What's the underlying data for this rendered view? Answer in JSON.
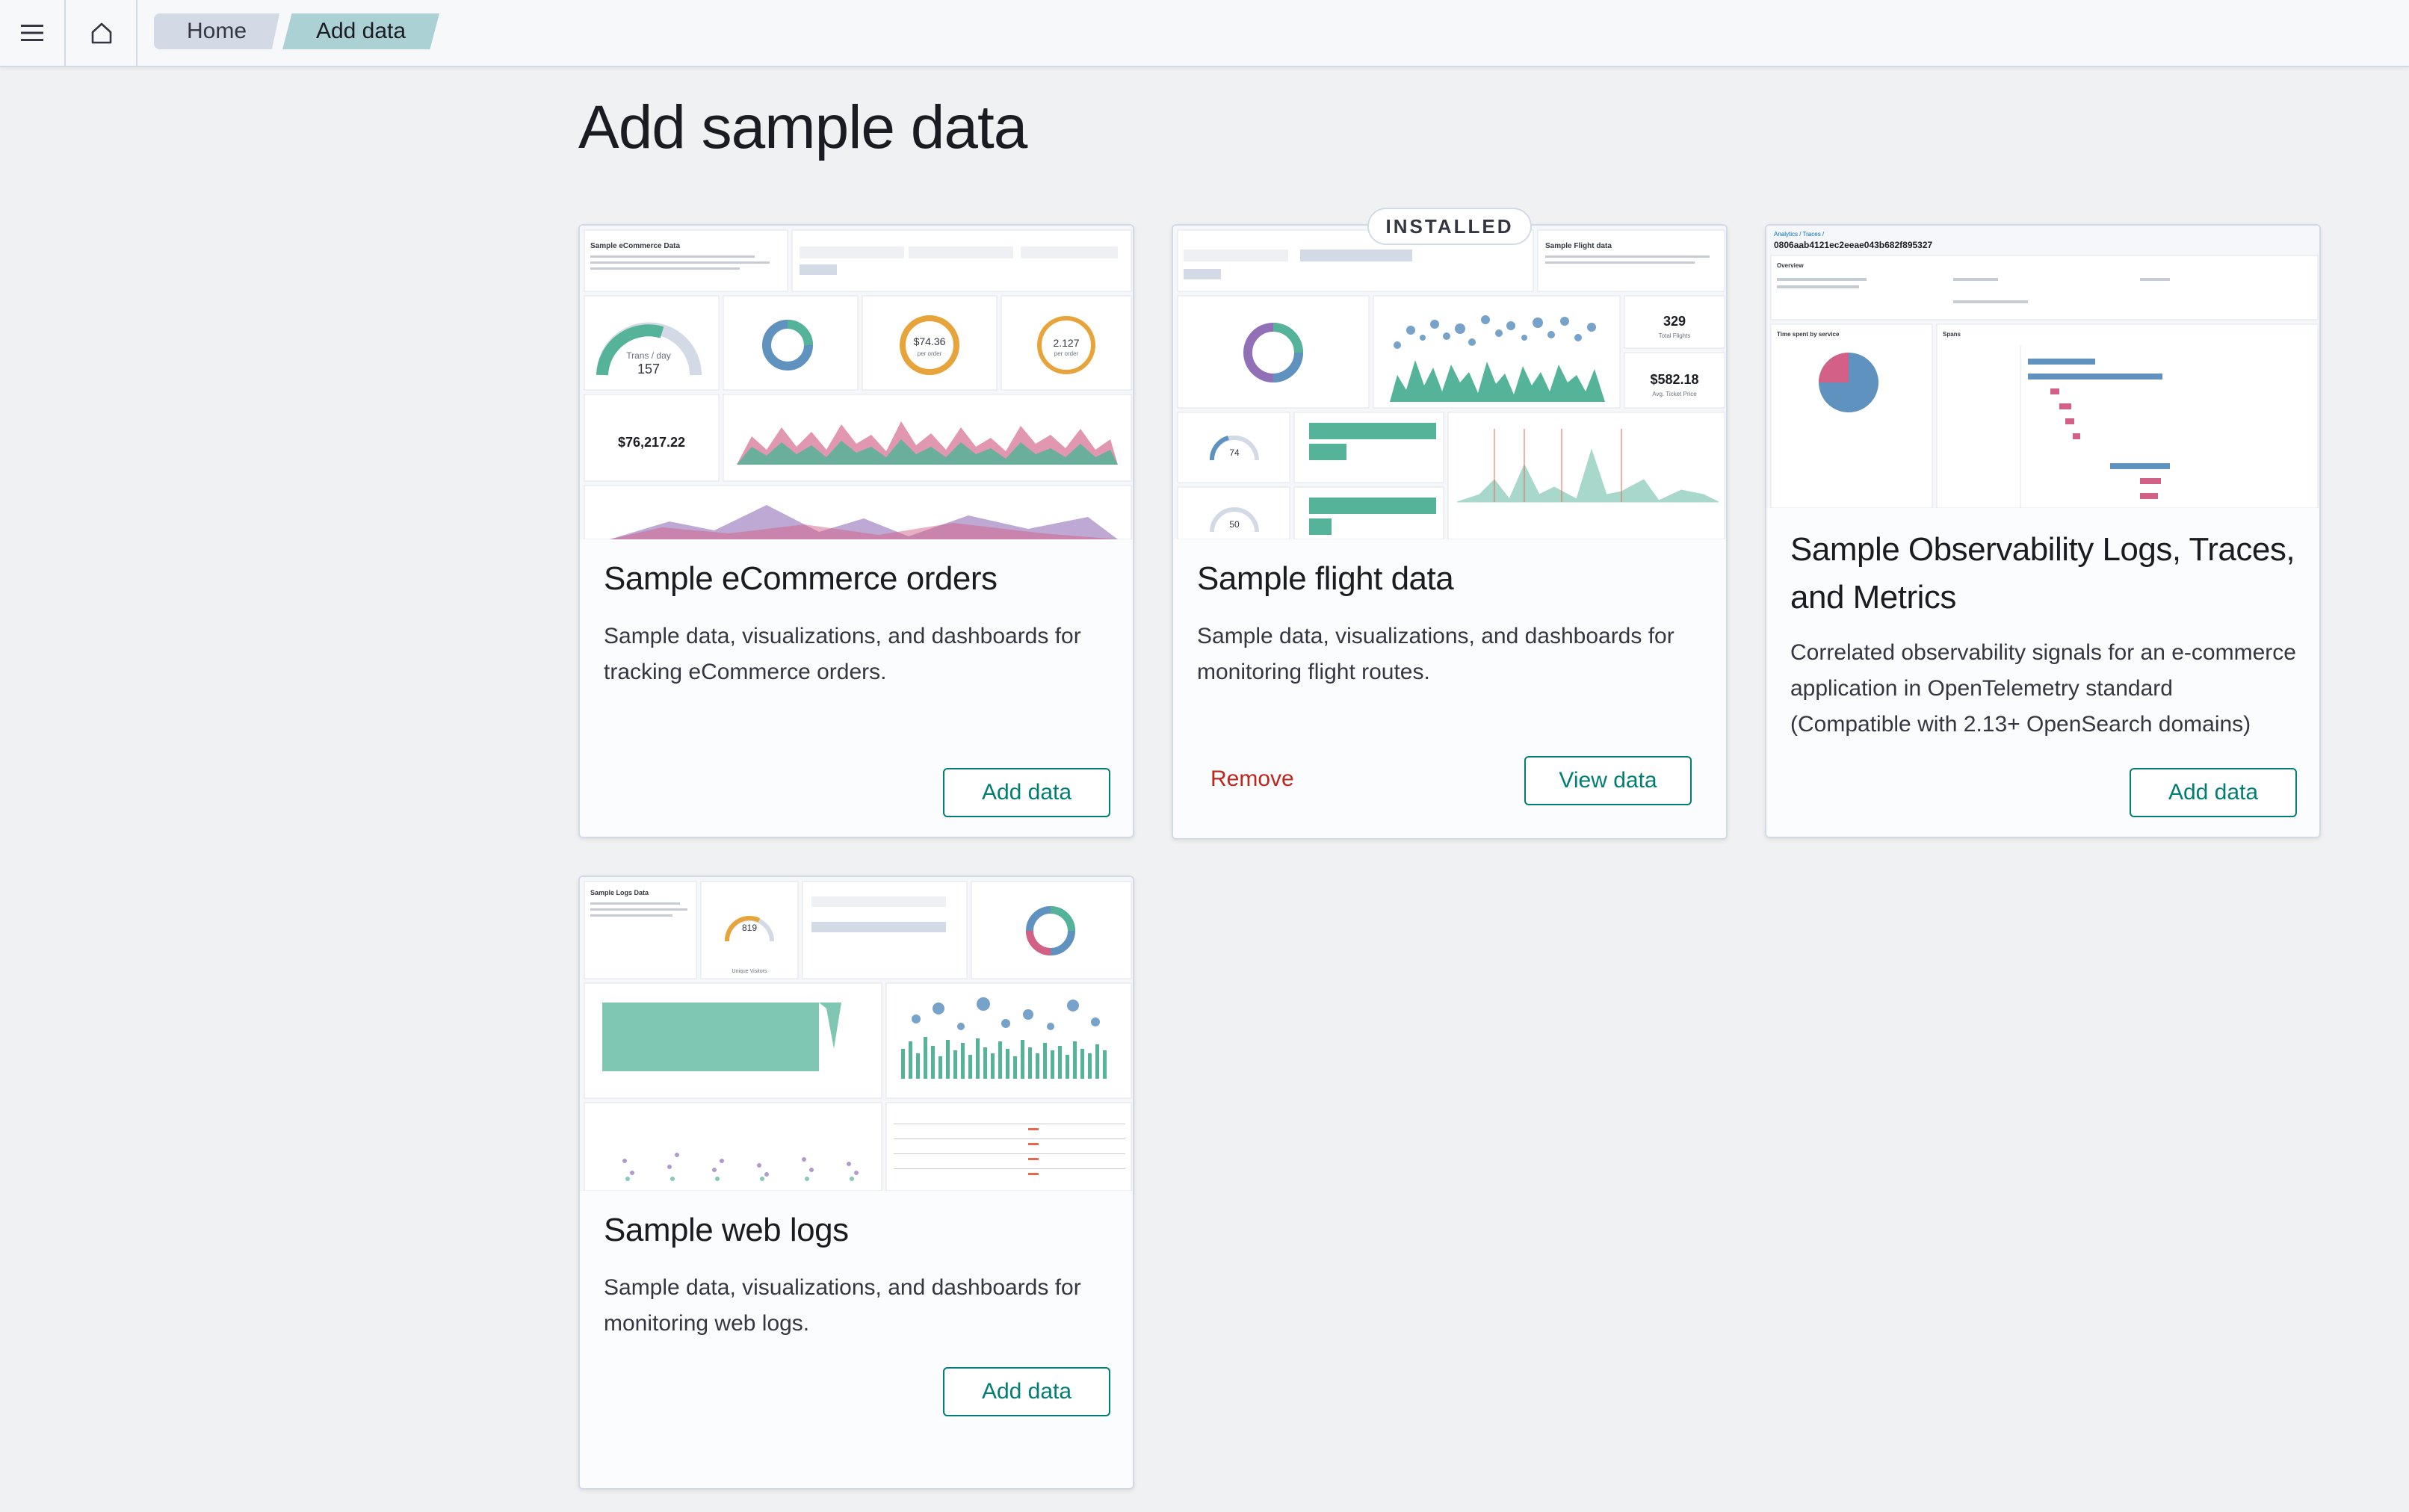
{
  "header": {
    "menu_icon": "hamburger-icon",
    "home_icon": "home-icon",
    "breadcrumbs": [
      "Home",
      "Add data"
    ]
  },
  "page": {
    "title": "Add sample data"
  },
  "cards": [
    {
      "title": "Sample eCommerce orders",
      "description": "Sample data, visualizations, and dashboards for tracking eCommerce orders.",
      "action": "Add data",
      "preview": {
        "panel_title": "Sample eCommerce Data",
        "gauge_label": "Trans / day",
        "gauge_value": "157",
        "avg_sales": "$74.36",
        "avg_sales_label": "per order",
        "avg_items": "2.127",
        "avg_items_label": "per order",
        "revenue": "$76,217.22"
      }
    },
    {
      "title": "Sample flight data",
      "description": "Sample data, visualizations, and dashboards for monitoring flight routes.",
      "badge": "INSTALLED",
      "action": "View data",
      "secondary_action": "Remove",
      "preview": {
        "panel_title": "Sample Flight data",
        "total_flights": "329",
        "total_flights_label": "Total Flights",
        "avg_ticket": "$582.18",
        "avg_ticket_label": "Avg. Ticket Price",
        "gauge_delays": "74",
        "gauge_cancel": "50"
      }
    },
    {
      "title": "Sample Observability Logs, Traces, and Metrics",
      "description": "Correlated observability signals for an e-commerce application in OpenTelemetry standard (Compatible with 2.13+ OpenSearch domains)",
      "action": "Add data",
      "preview": {
        "breadcrumb": "Analytics / Traces /",
        "trace_id": "0806aab4121ec2eeae043b682f895327",
        "overview": "Overview",
        "time_spent": "Time spent by service",
        "spans": "Spans"
      }
    },
    {
      "title": "Sample web logs",
      "description": "Sample data, visualizations, and dashboards for monitoring web logs.",
      "action": "Add data",
      "preview": {
        "panel_title": "Sample Logs Data",
        "gauge_value": "819",
        "gauge_label": "Unique Visitors"
      }
    }
  ],
  "colors": {
    "accent": "#017d73",
    "danger": "#bd271e",
    "chart_green": "#54b399",
    "chart_blue": "#6092c0",
    "chart_orange": "#e7a43a",
    "chart_pink": "#d36086",
    "chart_purple": "#9170b8"
  }
}
